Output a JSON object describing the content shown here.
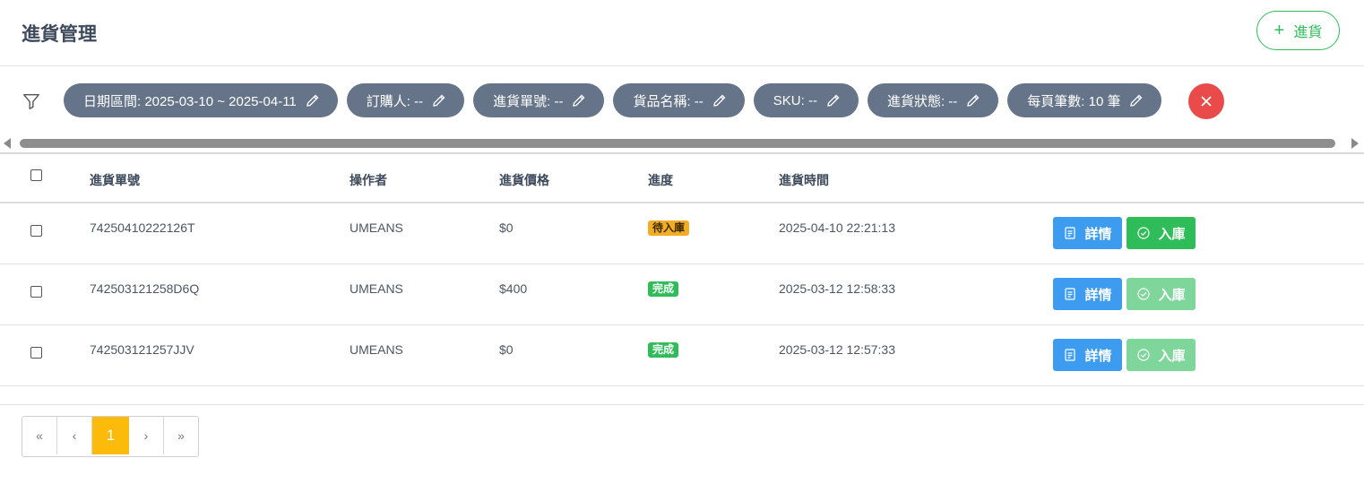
{
  "header": {
    "title": "進貨管理",
    "add_button_label": "進貨"
  },
  "filters": {
    "chips": [
      {
        "label": "日期區間: 2025-03-10 ~ 2025-04-11"
      },
      {
        "label": "訂購人: --"
      },
      {
        "label": "進貨單號: --"
      },
      {
        "label": "貨品名稱: --"
      },
      {
        "label": "SKU: --"
      },
      {
        "label": "進貨狀態: --"
      },
      {
        "label": "每頁筆數: 10 筆"
      }
    ]
  },
  "table": {
    "columns": [
      "進貨單號",
      "操作者",
      "進貨價格",
      "進度",
      "進貨時間"
    ],
    "rows": [
      {
        "order_no": "74250410222126T",
        "operator": "UMEANS",
        "price": "$0",
        "status": "待入庫",
        "time": "2025-04-10 22:21:13",
        "detail_label": "詳情",
        "instock_label": "入庫"
      },
      {
        "order_no": "742503121258D6Q",
        "operator": "UMEANS",
        "price": "$400",
        "status": "完成",
        "time": "2025-03-12 12:58:33",
        "detail_label": "詳情",
        "instock_label": "入庫"
      },
      {
        "order_no": "742503121257JJV",
        "operator": "UMEANS",
        "price": "$0",
        "status": "完成",
        "time": "2025-03-12 12:57:33",
        "detail_label": "詳情",
        "instock_label": "入庫"
      }
    ]
  },
  "pagination": {
    "first": "«",
    "prev": "‹",
    "current": "1",
    "next": "›",
    "last": "»"
  },
  "colors": {
    "accent_green": "#2ebd59",
    "chip_gray": "#657488",
    "clear_red": "#e94b4b",
    "detail_blue": "#3d9cf0",
    "pending_orange": "#f2ad24",
    "page_active": "#fcbb0a"
  }
}
